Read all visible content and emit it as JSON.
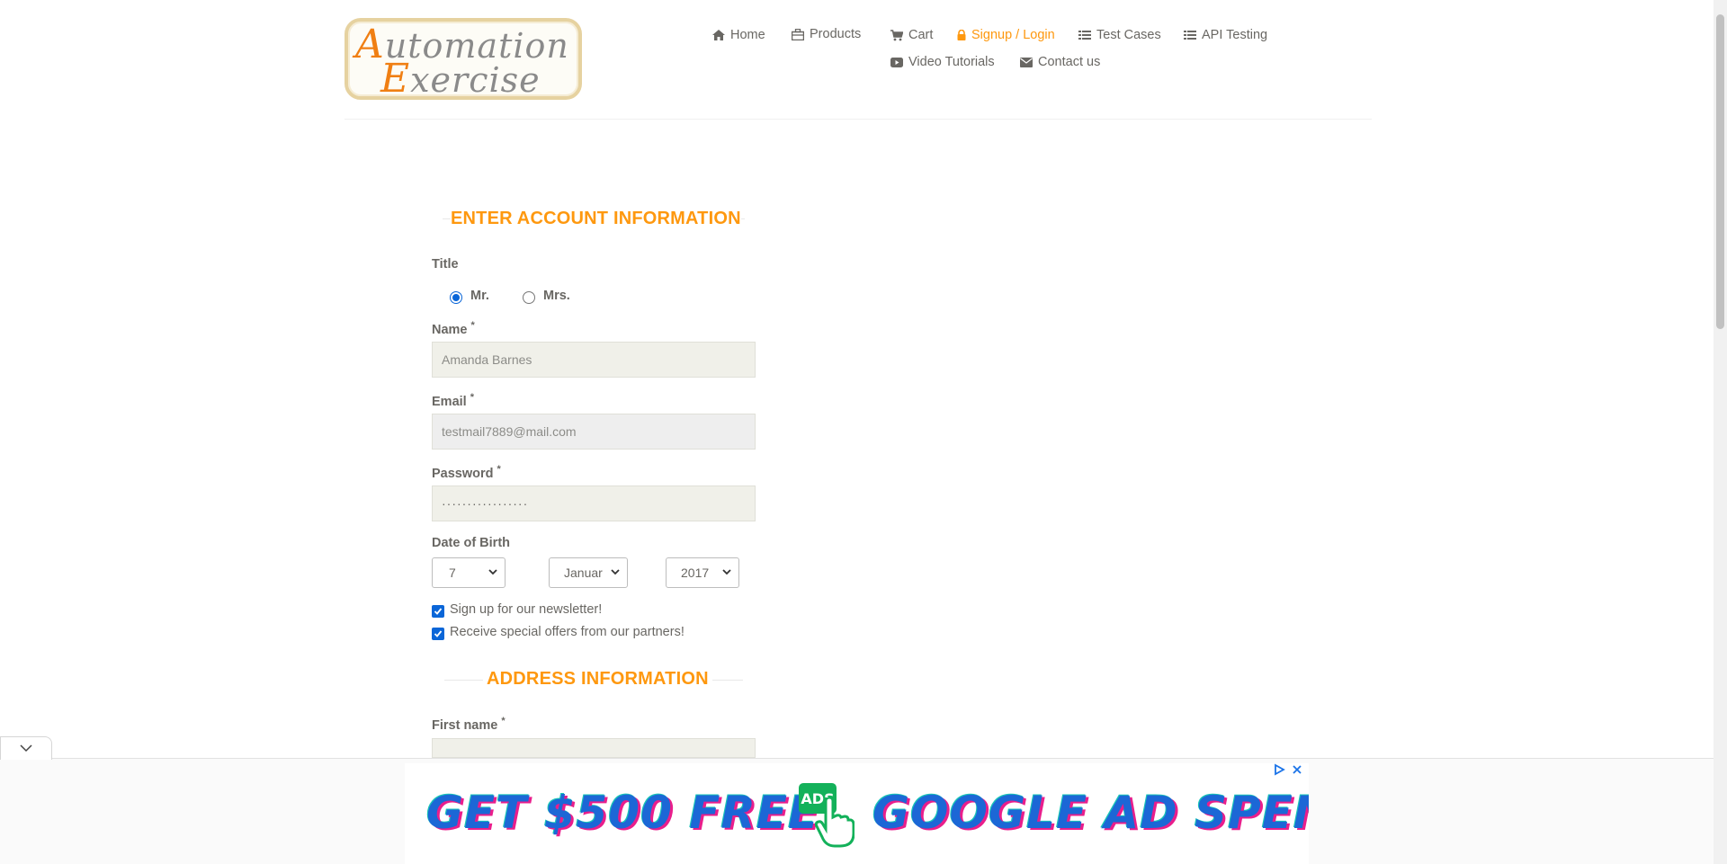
{
  "logo": {
    "line1_cap": "A",
    "line1_rest": "utomation",
    "line2_cap": "E",
    "line2_rest": "xercise"
  },
  "nav": {
    "items": [
      {
        "label": "Home",
        "icon": "home-icon"
      },
      {
        "label": "Products",
        "icon": "products-icon"
      },
      {
        "label": "Cart",
        "icon": "cart-icon"
      },
      {
        "label": "Signup / Login",
        "icon": "lock-icon",
        "active": true
      },
      {
        "label": "Test Cases",
        "icon": "list-icon"
      },
      {
        "label": "API Testing",
        "icon": "list-icon"
      },
      {
        "label": "Video Tutorials",
        "icon": "youtube-icon"
      },
      {
        "label": "Contact us",
        "icon": "envelope-icon"
      }
    ]
  },
  "account": {
    "heading": "ENTER ACCOUNT INFORMATION",
    "title_label": "Title",
    "title_options": [
      "Mr.",
      "Mrs."
    ],
    "title_selected": "Mr.",
    "name_label": "Name",
    "name_value": "Amanda Barnes",
    "email_label": "Email",
    "email_value": "testmail7889@mail.com",
    "password_label": "Password",
    "password_value": "·················",
    "dob_label": "Date of Birth",
    "dob_day": "7",
    "dob_month": "Januar",
    "dob_year": "2017",
    "newsletter_label": "Sign up for our newsletter!",
    "offers_label": "Receive special offers from our partners!",
    "required_mark": "*"
  },
  "address": {
    "heading": "ADDRESS INFORMATION",
    "first_name_label": "First name"
  },
  "ad": {
    "text_left": "GET $500 FREE",
    "badge": "ADS",
    "text_right": "GOOGLE AD SPEND"
  },
  "colors": {
    "accent": "#fe980f",
    "text": "#696763",
    "field_bg": "#f0f0e9",
    "checkbox": "#0a66d8"
  }
}
